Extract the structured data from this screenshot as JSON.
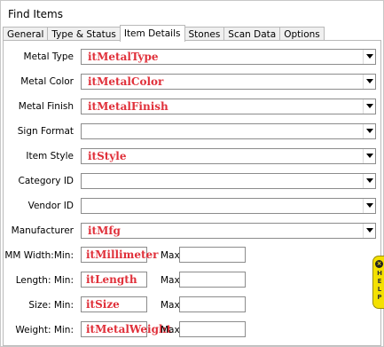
{
  "window": {
    "title": "Find Items"
  },
  "tabs": [
    {
      "label": "General"
    },
    {
      "label": "Type & Status"
    },
    {
      "label": "Item Details"
    },
    {
      "label": "Stones"
    },
    {
      "label": "Scan Data"
    },
    {
      "label": "Options"
    }
  ],
  "fields": {
    "metal_type": {
      "label": "Metal Type",
      "value": "itMetalType"
    },
    "metal_color": {
      "label": "Metal Color",
      "value": "itMetalColor"
    },
    "metal_finish": {
      "label": "Metal Finish",
      "value": "itMetalFinish"
    },
    "sign_format": {
      "label": "Sign Format",
      "value": ""
    },
    "item_style": {
      "label": "Item Style",
      "value": "itStyle"
    },
    "category_id": {
      "label": "Category ID",
      "value": ""
    },
    "vendor_id": {
      "label": "Vendor ID",
      "value": ""
    },
    "manufacturer": {
      "label": "Manufacturer",
      "value": "itMfg"
    }
  },
  "ranges": {
    "mm_width": {
      "label": "MM Width:Min:",
      "min_value": "itMillimeter",
      "max_label": "Max:",
      "max_value": ""
    },
    "length": {
      "label": "Length:  Min:",
      "min_value": "itLength",
      "max_label": "Max:",
      "max_value": ""
    },
    "size": {
      "label": "Size:  Min:",
      "min_value": "itSize",
      "max_label": "Max:",
      "max_value": ""
    },
    "weight": {
      "label": "Weight:  Min:",
      "min_value": "itMetalWeight",
      "max_label": "Max:",
      "max_value": ""
    }
  },
  "help": {
    "text": "HELP"
  },
  "colors": {
    "value_text": "#e0303a",
    "help_tab": "#f4e100"
  }
}
